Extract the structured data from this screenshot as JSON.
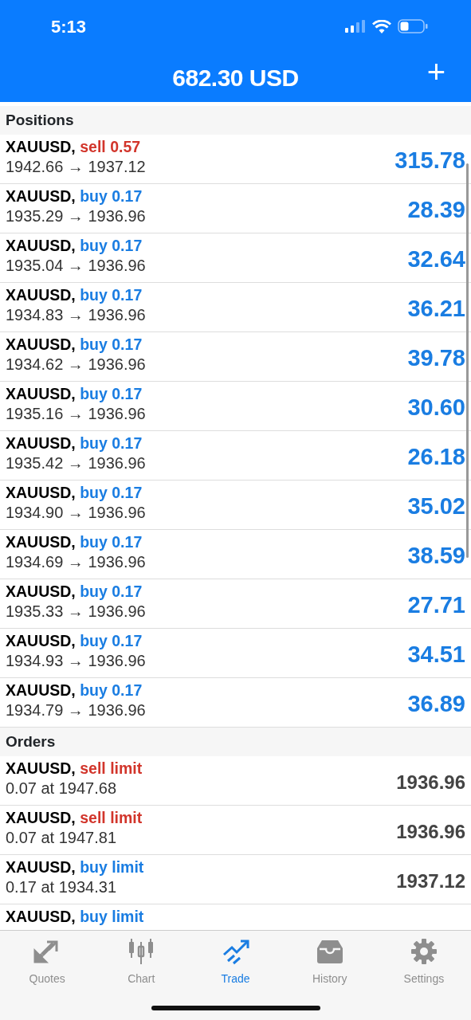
{
  "status_bar": {
    "time": "5:13"
  },
  "header": {
    "title": "682.30 USD",
    "add_button": "+"
  },
  "positions": {
    "title": "Positions",
    "rows": [
      {
        "symbol": "XAUUSD,",
        "side": "sell",
        "volume": "0.57",
        "prices": "1942.66 → 1937.12",
        "profit": "315.78"
      },
      {
        "symbol": "XAUUSD,",
        "side": "buy",
        "volume": "0.17",
        "prices": "1935.29 → 1936.96",
        "profit": "28.39"
      },
      {
        "symbol": "XAUUSD,",
        "side": "buy",
        "volume": "0.17",
        "prices": "1935.04 → 1936.96",
        "profit": "32.64"
      },
      {
        "symbol": "XAUUSD,",
        "side": "buy",
        "volume": "0.17",
        "prices": "1934.83 → 1936.96",
        "profit": "36.21"
      },
      {
        "symbol": "XAUUSD,",
        "side": "buy",
        "volume": "0.17",
        "prices": "1934.62 → 1936.96",
        "profit": "39.78"
      },
      {
        "symbol": "XAUUSD,",
        "side": "buy",
        "volume": "0.17",
        "prices": "1935.16 → 1936.96",
        "profit": "30.60"
      },
      {
        "symbol": "XAUUSD,",
        "side": "buy",
        "volume": "0.17",
        "prices": "1935.42 → 1936.96",
        "profit": "26.18"
      },
      {
        "symbol": "XAUUSD,",
        "side": "buy",
        "volume": "0.17",
        "prices": "1934.90 → 1936.96",
        "profit": "35.02"
      },
      {
        "symbol": "XAUUSD,",
        "side": "buy",
        "volume": "0.17",
        "prices": "1934.69 → 1936.96",
        "profit": "38.59"
      },
      {
        "symbol": "XAUUSD,",
        "side": "buy",
        "volume": "0.17",
        "prices": "1935.33 → 1936.96",
        "profit": "27.71"
      },
      {
        "symbol": "XAUUSD,",
        "side": "buy",
        "volume": "0.17",
        "prices": "1934.93 → 1936.96",
        "profit": "34.51"
      },
      {
        "symbol": "XAUUSD,",
        "side": "buy",
        "volume": "0.17",
        "prices": "1934.79 → 1936.96",
        "profit": "36.89"
      }
    ]
  },
  "orders": {
    "title": "Orders",
    "rows": [
      {
        "symbol": "XAUUSD,",
        "side": "sell",
        "type": "limit",
        "detail": "0.07 at 1947.68",
        "price": "1936.96"
      },
      {
        "symbol": "XAUUSD,",
        "side": "sell",
        "type": "limit",
        "detail": "0.07 at 1947.81",
        "price": "1936.96"
      },
      {
        "symbol": "XAUUSD,",
        "side": "buy",
        "type": "limit",
        "detail": "0.17 at 1934.31",
        "price": "1937.12"
      },
      {
        "symbol": "XAUUSD,",
        "side": "buy",
        "type": "limit"
      }
    ]
  },
  "tabs": [
    {
      "label": "Quotes",
      "kind": "quotes",
      "selected": false
    },
    {
      "label": "Chart",
      "kind": "chart",
      "selected": false
    },
    {
      "label": "Trade",
      "kind": "trade",
      "selected": true
    },
    {
      "label": "History",
      "kind": "history",
      "selected": false
    },
    {
      "label": "Settings",
      "kind": "settings",
      "selected": false
    }
  ]
}
